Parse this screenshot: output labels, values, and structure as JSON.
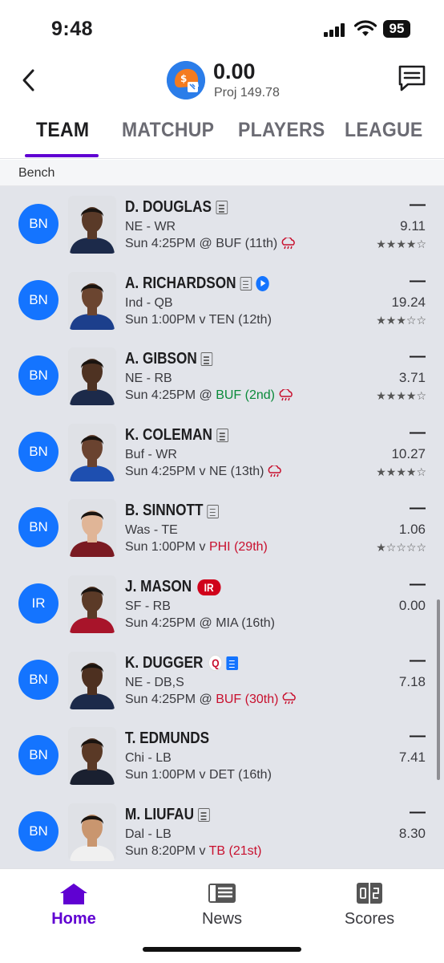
{
  "status_bar": {
    "time": "9:48",
    "battery": "95"
  },
  "header": {
    "score": "0.00",
    "projection": "Proj 149.78"
  },
  "tabs": [
    {
      "label": "TEAM",
      "active": true
    },
    {
      "label": "MATCHUP",
      "active": false
    },
    {
      "label": "PLAYERS",
      "active": false
    },
    {
      "label": "LEAGUE",
      "active": false
    }
  ],
  "section": {
    "title": "Bench"
  },
  "players": [
    {
      "slot": "BN",
      "name": "D. DOUGLAS",
      "team_pos": "NE - WR",
      "game_prefix": "Sun 4:25PM @ ",
      "opponent": "BUF (11th)",
      "opp_color": "normal",
      "dash": "—",
      "points": "9.11",
      "stars": "★★★★☆",
      "has_note": true,
      "rain": true
    },
    {
      "slot": "BN",
      "name": "A. RICHARDSON",
      "team_pos": "Ind - QB",
      "game_prefix": "Sun 1:00PM v ",
      "opponent": "TEN (12th)",
      "opp_color": "normal",
      "dash": "—",
      "points": "19.24",
      "stars": "★★★☆☆",
      "has_note": true,
      "play": true
    },
    {
      "slot": "BN",
      "name": "A. GIBSON",
      "team_pos": "NE - RB",
      "game_prefix": "Sun 4:25PM @ ",
      "opponent": "BUF (2nd)",
      "opp_color": "green",
      "dash": "—",
      "points": "3.71",
      "stars": "★★★★☆",
      "has_note": true,
      "rain": true
    },
    {
      "slot": "BN",
      "name": "K. COLEMAN",
      "team_pos": "Buf - WR",
      "game_prefix": "Sun 4:25PM v ",
      "opponent": "NE (13th)",
      "opp_color": "normal",
      "dash": "—",
      "points": "10.27",
      "stars": "★★★★☆",
      "has_note": true,
      "rain": true
    },
    {
      "slot": "BN",
      "name": "B. SINNOTT",
      "team_pos": "Was - TE",
      "game_prefix": "Sun 1:00PM v ",
      "opponent": "PHI (29th)",
      "opp_color": "red",
      "dash": "—",
      "points": "1.06",
      "stars": "★☆☆☆☆",
      "has_note": true
    },
    {
      "slot": "IR",
      "name": "J. MASON",
      "team_pos": "SF - RB",
      "game_prefix": "Sun 4:25PM @ ",
      "opponent": "MIA (16th)",
      "opp_color": "normal",
      "dash": "—",
      "points": "0.00",
      "stars": "",
      "badge": "IR"
    },
    {
      "slot": "BN",
      "name": "K. DUGGER",
      "team_pos": "NE - DB,S",
      "game_prefix": "Sun 4:25PM @ ",
      "opponent": "BUF (30th)",
      "opp_color": "red",
      "dash": "—",
      "points": "7.18",
      "stars": "",
      "badge": "Q",
      "blue_note": true,
      "rain": true
    },
    {
      "slot": "BN",
      "name": "T. EDMUNDS",
      "team_pos": "Chi - LB",
      "game_prefix": "Sun 1:00PM v ",
      "opponent": "DET (16th)",
      "opp_color": "normal",
      "dash": "—",
      "points": "7.41",
      "stars": ""
    },
    {
      "slot": "BN",
      "name": "M. LIUFAU",
      "team_pos": "Dal - LB",
      "game_prefix": "Sun 8:20PM v ",
      "opponent": "TB (21st)",
      "opp_color": "red",
      "dash": "—",
      "points": "8.30",
      "stars": "",
      "has_note": true
    }
  ],
  "bottom_nav": [
    {
      "label": "Home",
      "icon": "home-icon",
      "active": true
    },
    {
      "label": "News",
      "icon": "news-icon",
      "active": false
    },
    {
      "label": "Scores",
      "icon": "scores-icon",
      "active": false
    }
  ],
  "colors": {
    "accent": "#6001d2",
    "slot_blue": "#1474ff",
    "list_bg": "#e2e4ea",
    "red": "#c8102e",
    "green": "#0a8a3a"
  }
}
